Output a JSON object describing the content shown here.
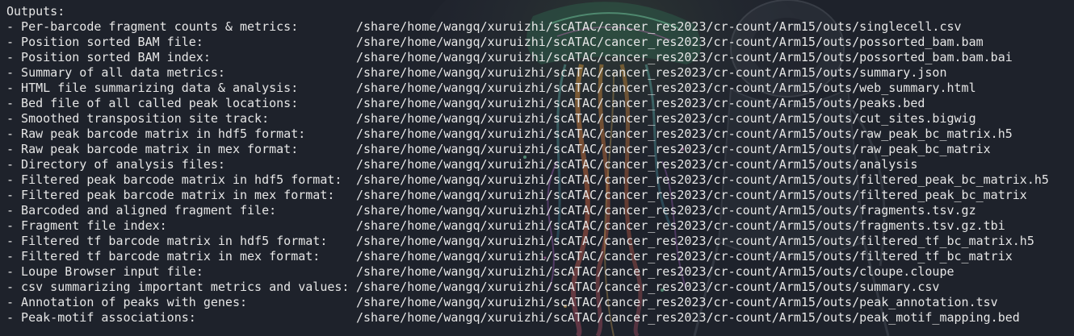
{
  "terminal": {
    "header": "Outputs:",
    "outputs": [
      {
        "desc": "- Per-barcode fragment counts & metrics:",
        "path": "/share/home/wangq/xuruizhi/scATAC/cancer_res2023/cr-count/Arm15/outs/singlecell.csv"
      },
      {
        "desc": "- Position sorted BAM file:",
        "path": "/share/home/wangq/xuruizhi/scATAC/cancer_res2023/cr-count/Arm15/outs/possorted_bam.bam"
      },
      {
        "desc": "- Position sorted BAM index:",
        "path": "/share/home/wangq/xuruizhi/scATAC/cancer_res2023/cr-count/Arm15/outs/possorted_bam.bam.bai"
      },
      {
        "desc": "- Summary of all data metrics:",
        "path": "/share/home/wangq/xuruizhi/scATAC/cancer_res2023/cr-count/Arm15/outs/summary.json"
      },
      {
        "desc": "- HTML file summarizing data & analysis:",
        "path": "/share/home/wangq/xuruizhi/scATAC/cancer_res2023/cr-count/Arm15/outs/web_summary.html"
      },
      {
        "desc": "- Bed file of all called peak locations:",
        "path": "/share/home/wangq/xuruizhi/scATAC/cancer_res2023/cr-count/Arm15/outs/peaks.bed"
      },
      {
        "desc": "- Smoothed transposition site track:",
        "path": "/share/home/wangq/xuruizhi/scATAC/cancer_res2023/cr-count/Arm15/outs/cut_sites.bigwig"
      },
      {
        "desc": "- Raw peak barcode matrix in hdf5 format:",
        "path": "/share/home/wangq/xuruizhi/scATAC/cancer_res2023/cr-count/Arm15/outs/raw_peak_bc_matrix.h5"
      },
      {
        "desc": "- Raw peak barcode matrix in mex format:",
        "path": "/share/home/wangq/xuruizhi/scATAC/cancer_res2023/cr-count/Arm15/outs/raw_peak_bc_matrix"
      },
      {
        "desc": "- Directory of analysis files:",
        "path": "/share/home/wangq/xuruizhi/scATAC/cancer_res2023/cr-count/Arm15/outs/analysis"
      },
      {
        "desc": "- Filtered peak barcode matrix in hdf5 format:",
        "path": "/share/home/wangq/xuruizhi/scATAC/cancer_res2023/cr-count/Arm15/outs/filtered_peak_bc_matrix.h5"
      },
      {
        "desc": "- Filtered peak barcode matrix in mex format:",
        "path": "/share/home/wangq/xuruizhi/scATAC/cancer_res2023/cr-count/Arm15/outs/filtered_peak_bc_matrix"
      },
      {
        "desc": "- Barcoded and aligned fragment file:",
        "path": "/share/home/wangq/xuruizhi/scATAC/cancer_res2023/cr-count/Arm15/outs/fragments.tsv.gz"
      },
      {
        "desc": "- Fragment file index:",
        "path": "/share/home/wangq/xuruizhi/scATAC/cancer_res2023/cr-count/Arm15/outs/fragments.tsv.gz.tbi"
      },
      {
        "desc": "- Filtered tf barcode matrix in hdf5 format:",
        "path": "/share/home/wangq/xuruizhi/scATAC/cancer_res2023/cr-count/Arm15/outs/filtered_tf_bc_matrix.h5"
      },
      {
        "desc": "- Filtered tf barcode matrix in mex format:",
        "path": "/share/home/wangq/xuruizhi/scATAC/cancer_res2023/cr-count/Arm15/outs/filtered_tf_bc_matrix"
      },
      {
        "desc": "- Loupe Browser input file:",
        "path": "/share/home/wangq/xuruizhi/scATAC/cancer_res2023/cr-count/Arm15/outs/cloupe.cloupe"
      },
      {
        "desc": "- csv summarizing important metrics and values:",
        "path": "/share/home/wangq/xuruizhi/scATAC/cancer_res2023/cr-count/Arm15/outs/summary.csv"
      },
      {
        "desc": "- Annotation of peaks with genes:",
        "path": "/share/home/wangq/xuruizhi/scATAC/cancer_res2023/cr-count/Arm15/outs/peak_annotation.tsv"
      },
      {
        "desc": "- Peak-motif associations:",
        "path": "/share/home/wangq/xuruizhi/scATAC/cancer_res2023/cr-count/Arm15/outs/peak_motif_mapping.bed"
      }
    ]
  },
  "colors": {
    "background": "#1e222b",
    "text": "#e6e6e6"
  },
  "wallpaper": {
    "icon": "jellyfish-astronaut-wallpaper"
  }
}
